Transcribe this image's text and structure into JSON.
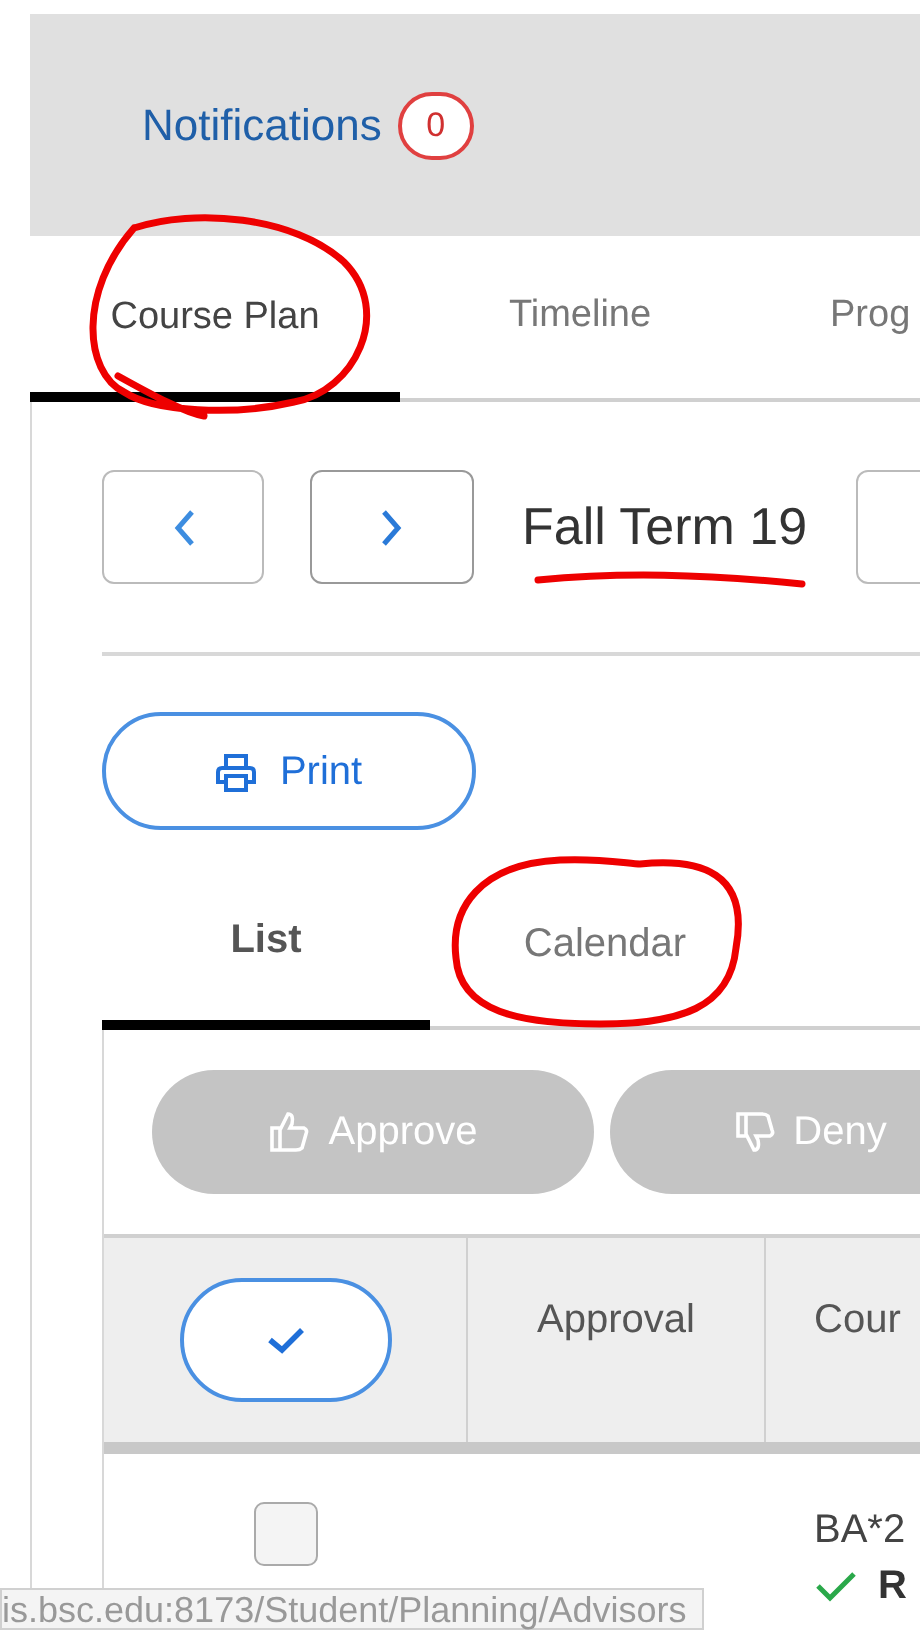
{
  "header": {
    "notifications": {
      "label": "Notifications",
      "count": "0"
    }
  },
  "tabs": [
    {
      "label": "Course Plan",
      "selected": true,
      "circled": true
    },
    {
      "label": "Timeline",
      "selected": false,
      "circled": false
    },
    {
      "label": "Prog",
      "selected": false,
      "circled": false
    }
  ],
  "term": {
    "title": "Fall Term 19",
    "underlined": true
  },
  "print_button": {
    "label": "Print"
  },
  "view_tabs": [
    {
      "label": "List",
      "selected": true,
      "circled": false
    },
    {
      "label": "Calendar",
      "selected": false,
      "circled": true
    }
  ],
  "actions": [
    {
      "label": "Approve",
      "kind": "approve",
      "disabled": true
    },
    {
      "label": "Deny",
      "kind": "deny",
      "disabled": true
    }
  ],
  "table": {
    "columns": [
      "Approval",
      "Cour"
    ],
    "rows": [
      {
        "checked": false,
        "course": "BA*2",
        "status": "R"
      }
    ]
  },
  "status_bar": {
    "url": "is.bsc.edu:8173/Student/Planning/Advisors"
  }
}
